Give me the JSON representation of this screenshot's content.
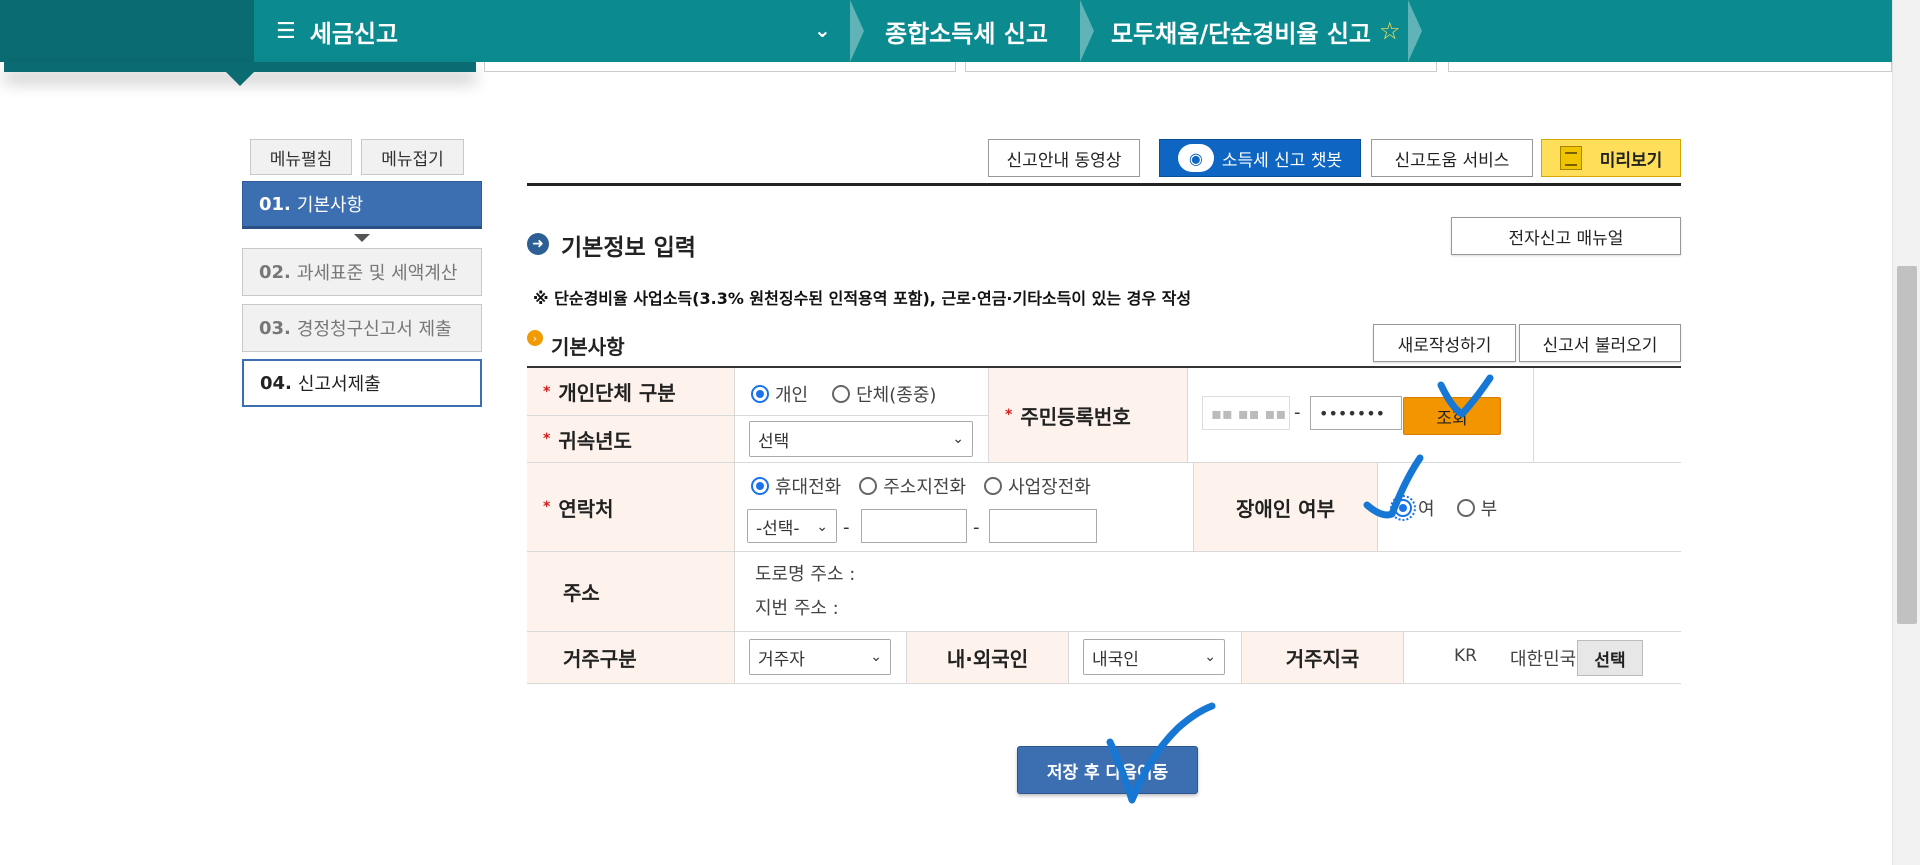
{
  "header": {
    "menu_title": "세금신고",
    "breadcrumb1": "종합소득세 신고",
    "breadcrumb2": "모두채움/단순경비율 신고"
  },
  "left_menu": {
    "expand_label": "메뉴펼침",
    "collapse_label": "메뉴접기",
    "steps": [
      {
        "num": "01.",
        "label": "기본사항"
      },
      {
        "num": "02.",
        "label": "과세표준 및 세액계산"
      },
      {
        "num": "03.",
        "label": "경정청구신고서 제출"
      },
      {
        "num": "04.",
        "label": "신고서제출"
      }
    ]
  },
  "toolbar": {
    "video_label": "신고안내 동영상",
    "chatbot_label": "소득세 신고 챗봇",
    "help_label": "신고도움 서비스",
    "preview_label": "미리보기"
  },
  "section": {
    "title": "기본정보 입력",
    "manual_label": "전자신고 매뉴얼",
    "notice": "※ 단순경비율 사업소득(3.3% 원천징수된 인적용역 포함), 근로·연금·기타소득이 있는 경우 작성",
    "sub_title": "기본사항",
    "new_label": "새로작성하기",
    "load_label": "신고서 불러오기"
  },
  "form": {
    "type_label": "개인단체 구분",
    "type_options": [
      "개인",
      "단체(종중)"
    ],
    "year_label": "귀속년도",
    "year_value": "선택",
    "rrn_label": "주민등록번호",
    "rrn_back": "•••••••",
    "search_label": "조회",
    "contact_label": "연락처",
    "contact_options": [
      "휴대전화",
      "주소지전화",
      "사업장전화"
    ],
    "phone_select": "-선택-",
    "disabled_label": "장애인 여부",
    "disabled_options": [
      "여",
      "부"
    ],
    "address_label": "주소",
    "road_address": "도로명 주소 :",
    "lot_address": "지번 주소 :",
    "residence_label": "거주구분",
    "residence_value": "거주자",
    "nationality_label": "내·외국인",
    "nationality_value": "내국인",
    "country_label": "거주지국",
    "country_code": "KR",
    "country_name": "대한민국",
    "pick_label": "선택"
  },
  "save_label": "저장 후 다음이동",
  "colors": {
    "teal": "#0b8a8f",
    "blue": "#3c6fb1",
    "orange": "#f29500",
    "mark": "#1777d4"
  }
}
